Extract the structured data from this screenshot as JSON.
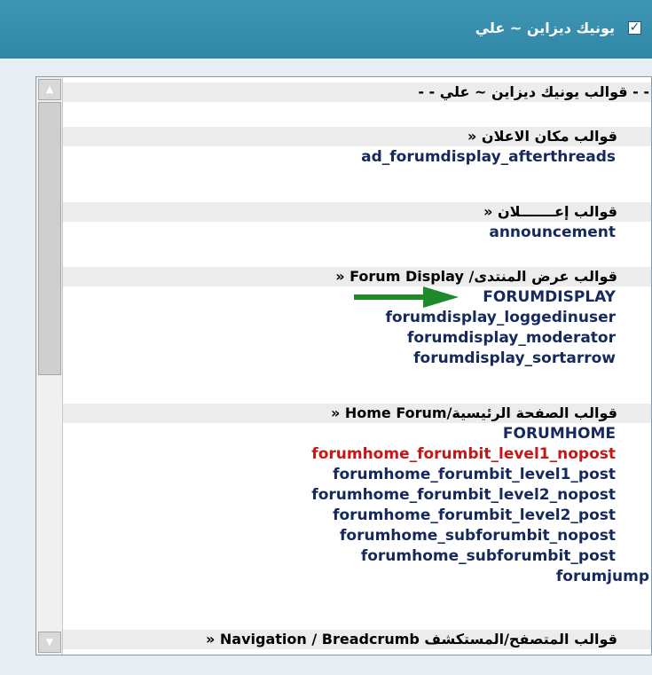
{
  "header": {
    "title": "يونيك ديزاين ~ علي",
    "checkbox_mark": "✓"
  },
  "list": {
    "top_heading": "- - قوالب يونيك ديزاين ~ علي - -",
    "groups": [
      {
        "heading": "قوالب مكان الاعلان «",
        "items": [
          "ad_forumdisplay_afterthreads"
        ]
      },
      {
        "heading": "قوالب إعـــــــلان «",
        "items": [
          "announcement"
        ]
      },
      {
        "heading": "قوالب عرض المنتدى/ Forum Display «",
        "items": [
          "FORUMDISPLAY",
          "forumdisplay_loggedinuser",
          "forumdisplay_moderator",
          "forumdisplay_sortarrow"
        ]
      },
      {
        "heading": "قوالب الصفحة الرئيسية/Home Forum «",
        "items": [
          "FORUMHOME",
          "forumhome_forumbit_level1_nopost",
          "forumhome_forumbit_level1_post",
          "forumhome_forumbit_level2_nopost",
          "forumhome_forumbit_level2_post",
          "forumhome_subforumbit_nopost",
          "forumhome_subforumbit_post",
          "forumjump"
        ]
      },
      {
        "heading": "قوالب المتصفح/المستكشف Navigation / Breadcrumb «",
        "items": []
      }
    ],
    "highlighted_item": "forumhome_forumbit_level1_nopost",
    "arrow_target": "FORUMDISPLAY"
  },
  "colors": {
    "header_bg": "#3090b0",
    "item_text": "#15295e",
    "highlight_text": "#c81616",
    "arrow": "#1f8a2a"
  },
  "icons": {
    "scroll_up": "triangle-up",
    "scroll_down": "triangle-down",
    "pointer": "green-arrow-right"
  }
}
